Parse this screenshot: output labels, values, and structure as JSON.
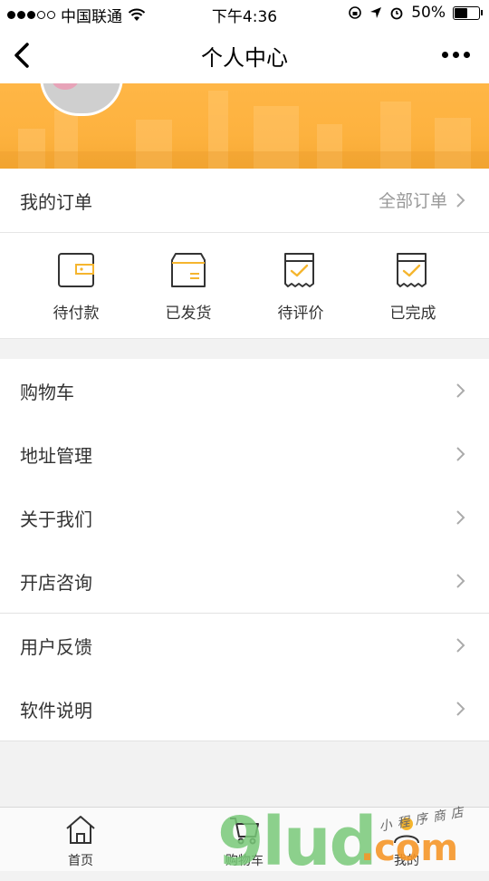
{
  "status": {
    "carrier": "中国联通",
    "time": "下午4:36",
    "battery": "50%"
  },
  "nav": {
    "title": "个人中心"
  },
  "orders": {
    "title": "我的订单",
    "all": "全部订单",
    "items": [
      {
        "label": "待付款",
        "icon": "wallet-icon"
      },
      {
        "label": "已发货",
        "icon": "box-icon"
      },
      {
        "label": "待评价",
        "icon": "review-icon"
      },
      {
        "label": "已完成",
        "icon": "completed-icon"
      }
    ]
  },
  "menu": [
    {
      "label": "购物车"
    },
    {
      "label": "地址管理"
    },
    {
      "label": "关于我们"
    },
    {
      "label": "开店咨询"
    },
    {
      "label": "用户反馈"
    },
    {
      "label": "软件说明"
    }
  ],
  "tabs": [
    {
      "label": "首页",
      "icon": "home-icon"
    },
    {
      "label": "购物车",
      "icon": "cart-icon"
    },
    {
      "label": "我的",
      "icon": "user-icon"
    }
  ],
  "watermark": {
    "main": "9lud",
    "suffix": ".com",
    "tag": "小程序商店"
  },
  "colors": {
    "accent": "#f5b52e",
    "banner": "#ffb646"
  }
}
